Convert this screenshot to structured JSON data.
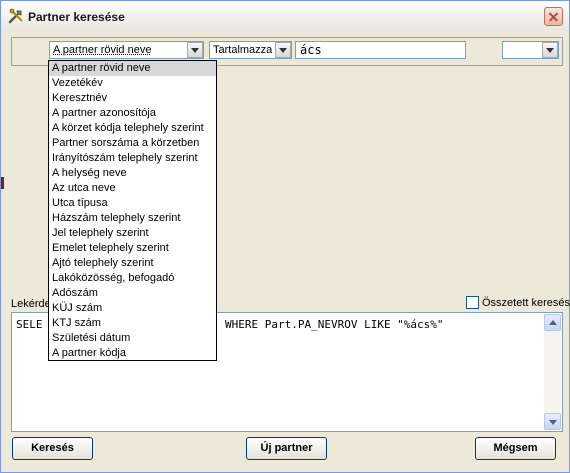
{
  "window": {
    "title": "Partner keresése"
  },
  "toolbar": {
    "field_select_value": "A partner rövid neve",
    "operator_select_value": "Tartalmazza",
    "search_value": "ács",
    "extra_select_value": ""
  },
  "field_options": [
    "A partner rövid neve",
    "Vezetékév",
    "Keresztnév",
    "A partner azonosítója",
    "A körzet kódja telephely szerint",
    "Partner sorszáma a körzetben",
    "Irányítószám telephely szerint",
    "A helység neve",
    "Az utca neve",
    "Utca típusa",
    "Házszám telephely szerint",
    "Jel telephely szerint",
    "Emelet telephely szerint",
    "Ajtó telephely szerint",
    "Lakóközösség, befogadó",
    "Adószám",
    "KÜJ szám",
    "KTJ szám",
    "Születési dátum",
    "A partner kódja"
  ],
  "query": {
    "label": "Lekérde",
    "text_left": "SELE",
    "text_right": "WHERE Part.PA_NEVROV LIKE \"%ács%\""
  },
  "complex_search": {
    "label": "Összetett keresés",
    "checked": false
  },
  "buttons": {
    "search": "Keresés",
    "new_partner": "Új partner",
    "cancel": "Mégsem"
  }
}
